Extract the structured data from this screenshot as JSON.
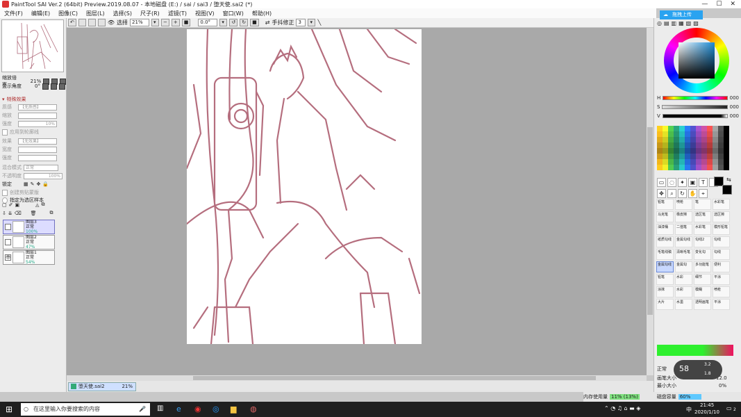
{
  "window": {
    "title": "PaintTool SAI Ver.2 (64bit) Preview.2019.08.07 - 本地磁盘 (E:) / sai / sai3 / 堕天使.sai2 (*)",
    "share_label": "拖拽上传"
  },
  "menu": [
    "文件(F)",
    "编辑(E)",
    "图像(C)",
    "图层(L)",
    "选择(S)",
    "尺子(R)",
    "滤镜(T)",
    "视图(V)",
    "窗口(W)",
    "帮助(H)"
  ],
  "toolbar": {
    "select_label": "选择",
    "zoom": "21%",
    "angle": "0.0°",
    "stabilizer_label": "手抖修正",
    "stabilizer_value": "3"
  },
  "navigator": {
    "zoom_label": "缩放倍率",
    "zoom_value": "21%",
    "angle_label": "显示角度",
    "angle_value": "0°"
  },
  "effects": {
    "header": "特殊效果",
    "texture_label": "质感",
    "texture_value": "【无质感】",
    "scale_label": "缩放",
    "strength_label": "强度",
    "strength_value": "10%",
    "apply_label": "应用到轮廓线",
    "effect_label": "效果",
    "effect_value": "【无效果】",
    "width_label": "宽度",
    "strength2_label": "强度",
    "blend_label": "混合模式",
    "blend_value": "正常",
    "opacity_label": "不透明度",
    "opacity_value": "100%",
    "lock_label": "锁定",
    "clip_label": "创建剪贴蒙版",
    "sample_label": "指定为选区样本"
  },
  "layers": [
    {
      "name": "图层3",
      "mode": "正常",
      "opacity": "100%",
      "active": true,
      "visible": false
    },
    {
      "name": "图层2",
      "mode": "正常",
      "opacity": "47%",
      "active": false,
      "visible": false
    },
    {
      "name": "图层1",
      "mode": "正常",
      "opacity": "54%",
      "active": false,
      "visible": true
    }
  ],
  "document": {
    "tab": "堕天使.sai2",
    "zoom": "21%"
  },
  "color": {
    "h_label": "H",
    "h_value": "000",
    "s_label": "S",
    "s_value": "000",
    "v_label": "V",
    "v_value": "000"
  },
  "brushes": [
    "铅笔",
    "喷枪",
    "笔",
    "水彩笔",
    "马克笔",
    "橡皮擦",
    "选区笔",
    "选区擦",
    "油漆桶",
    "二值笔",
    "水彩笔",
    "模形铅笔",
    "纸质勾线",
    "金属勾线",
    "勾线2",
    "勾线",
    "毛笔线稿",
    "清晰毛笔",
    "变化勾",
    "勾线",
    "金属勾线",
    "金属勾",
    "多功能笔",
    "便利",
    "铅笔",
    "水彩",
    "细节",
    "平涂",
    "涂抹",
    "水彩",
    "模糊",
    "喷枪",
    "大片",
    "水墨",
    "透明画笔",
    "平涂"
  ],
  "brush_panel": {
    "mode_label": "正常",
    "size_label": "画笔大小",
    "size_value": "12.0",
    "min_label": "最小大小",
    "min_value": "0%",
    "overlay_percent": "58",
    "overlay_up": "3.2",
    "overlay_down": "1.8"
  },
  "status": {
    "memory_label": "内存使用量",
    "memory_value": "11% (13%)",
    "disk_label": "磁盘容量",
    "disk_value": "60%"
  },
  "taskbar": {
    "search_placeholder": "在这里输入你要搜索的内容",
    "ime": "中",
    "time": "21:45",
    "date": "2020/1/10",
    "notify": "2"
  }
}
